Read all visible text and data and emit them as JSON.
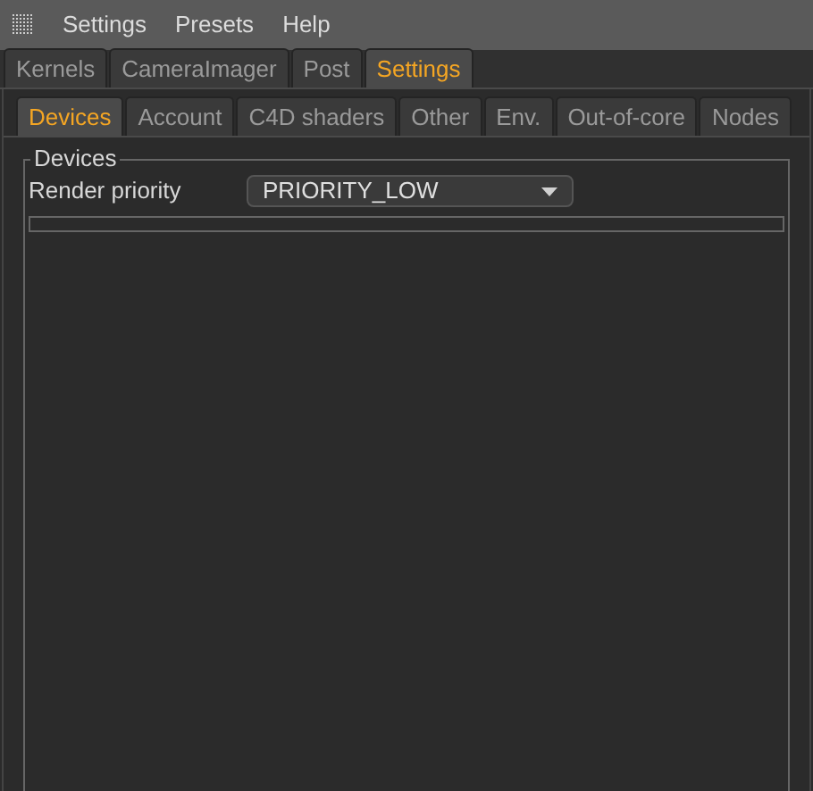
{
  "menu": [
    "Settings",
    "Presets",
    "Help"
  ],
  "tabs": [
    {
      "label": "Kernels",
      "selected": false
    },
    {
      "label": "CameraImager",
      "selected": false
    },
    {
      "label": "Post",
      "selected": false
    },
    {
      "label": "Settings",
      "selected": true
    }
  ],
  "subtabs": [
    {
      "label": "Devices",
      "selected": true
    },
    {
      "label": "Account",
      "selected": false
    },
    {
      "label": "C4D shaders",
      "selected": false
    },
    {
      "label": "Other",
      "selected": false
    },
    {
      "label": "Env.",
      "selected": false
    },
    {
      "label": "Out-of-core",
      "selected": false
    },
    {
      "label": "Nodes",
      "selected": false
    }
  ],
  "group": {
    "title": "Devices",
    "field_label": "Render priority",
    "value": "PRIORITY_LOW"
  }
}
